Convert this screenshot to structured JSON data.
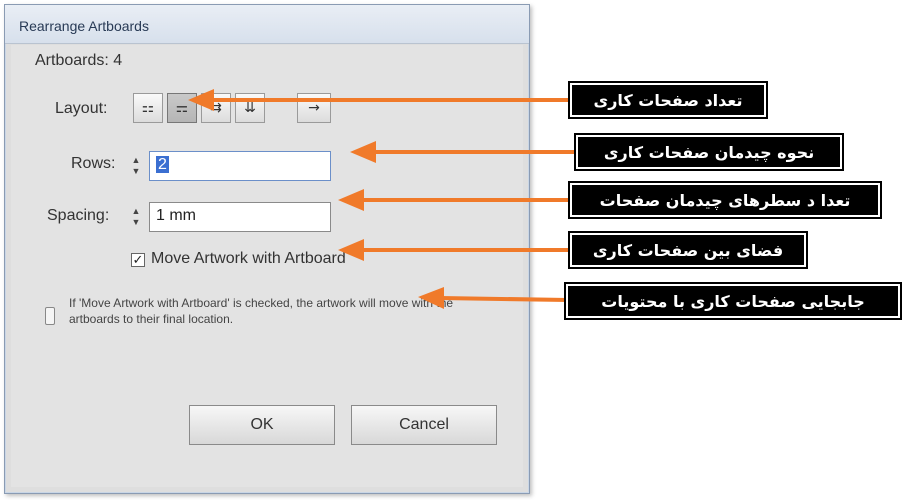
{
  "dialog": {
    "title": "Rearrange Artboards",
    "artboards_label": "Artboards: 4",
    "layout_label": "Layout:",
    "layout_buttons": [
      {
        "icon": "grid-by-row-icon",
        "glyph": "⚏"
      },
      {
        "icon": "grid-by-column-icon",
        "glyph": "⚎",
        "selected": true
      },
      {
        "icon": "arrange-by-row-icon",
        "glyph": "⇉"
      },
      {
        "icon": "arrange-by-column-icon",
        "glyph": "⇊"
      }
    ],
    "direction_button": {
      "icon": "left-to-right-icon",
      "glyph": "→"
    },
    "rows_label": "Rows:",
    "rows_value": "2",
    "spacing_label": "Spacing:",
    "spacing_value": "1 mm",
    "move_artwork": {
      "label": "Move Artwork with Artboard",
      "checked": true,
      "mark": "✓"
    },
    "info_text": "If 'Move Artwork with Artboard' is checked, the artwork will move with the artboards to their final location.",
    "ok_label": "OK",
    "cancel_label": "Cancel"
  },
  "callouts": [
    "تعداد صفحات کاری",
    "نحوه چیدمان صفحات کاری",
    "تعدا د سطرهای چیدمان صفحات",
    "فضای بین صفحات کاری",
    "جابجایی صفحات کاری با محتویات"
  ],
  "colors": {
    "arrow": "#f07a2a",
    "callout_bg": "#000000",
    "callout_text": "#ffffff"
  }
}
